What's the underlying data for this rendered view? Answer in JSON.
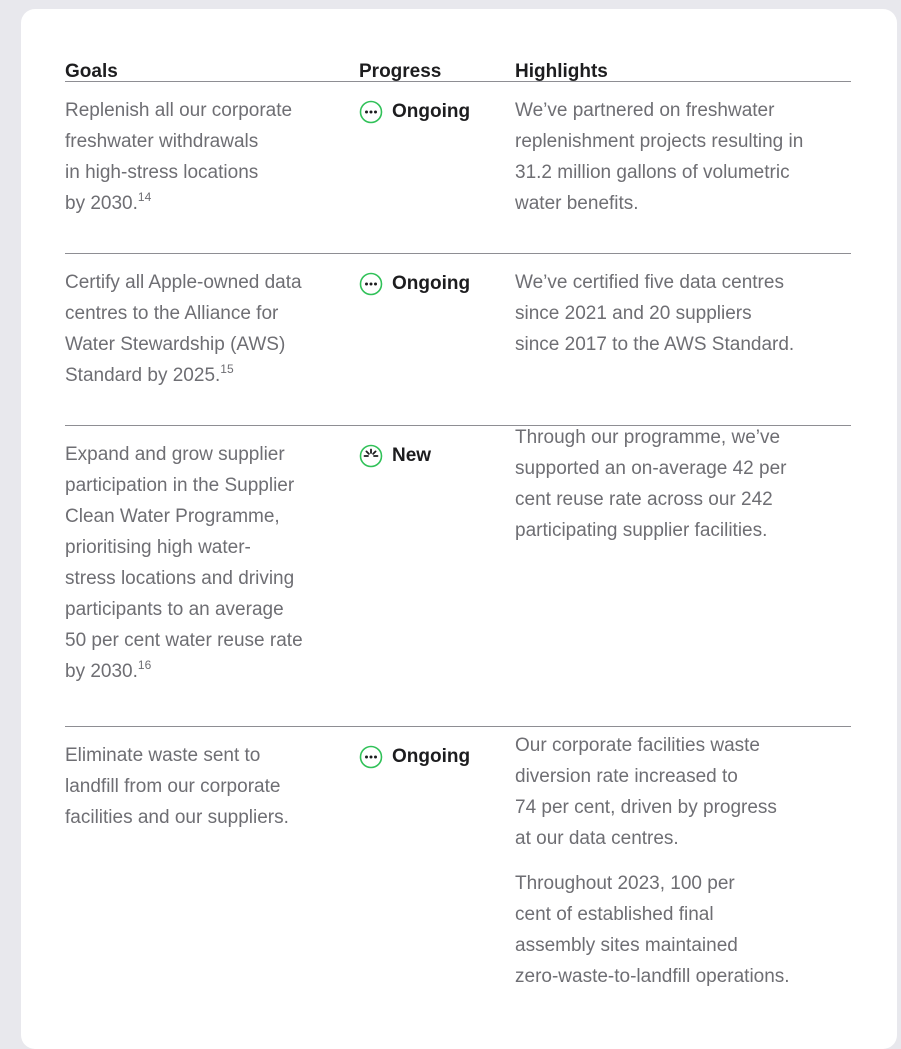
{
  "header": {
    "goals": "Goals",
    "progress": "Progress",
    "highlights": "Highlights"
  },
  "colors": {
    "status_green": "#30c158"
  },
  "rows": [
    {
      "goal_lines": [
        "Replenish all our corporate",
        "freshwater withdrawals",
        "in high-stress locations",
        "by 2030."
      ],
      "goal_sup": "14",
      "status": "Ongoing",
      "status_icon": "ellipsis-circle-icon",
      "highlights": [
        [
          "We’ve partnered on freshwater",
          "replenishment projects resulting in",
          "31.2 million gallons of volumetric",
          "water benefits."
        ]
      ]
    },
    {
      "goal_lines": [
        "Certify all Apple-owned data",
        "centres to the Alliance for",
        "Water Stewardship (AWS)",
        "Standard by 2025."
      ],
      "goal_sup": "15",
      "status": "Ongoing",
      "status_icon": "ellipsis-circle-icon",
      "highlights": [
        [
          "We’ve certified five data centres",
          "since 2021 and 20 suppliers",
          "since 2017 to the AWS Standard."
        ]
      ]
    },
    {
      "goal_lines": [
        "Expand and grow supplier",
        "participation in the Supplier",
        "Clean Water Programme,",
        "prioritising high water-",
        "stress locations and driving",
        "participants to an average",
        "50 per cent water reuse rate",
        "by 2030."
      ],
      "goal_sup": "16",
      "status": "New",
      "status_icon": "sparkle-circle-icon",
      "highlights": [
        [
          "Through our programme, we’ve",
          "supported an on-average 42 per",
          "cent reuse rate across our 242",
          "participating supplier facilities."
        ]
      ]
    },
    {
      "goal_lines": [
        "Eliminate waste sent to",
        "landfill from our corporate",
        "facilities and our suppliers."
      ],
      "goal_sup": "",
      "status": "Ongoing",
      "status_icon": "ellipsis-circle-icon",
      "highlights": [
        [
          "Our corporate facilities waste",
          "diversion rate increased to",
          "74 per cent, driven by progress",
          "at our data centres."
        ],
        [
          "Throughout 2023, 100 per",
          "cent of established final",
          "assembly sites maintained",
          "zero-waste-to-landfill operations."
        ]
      ]
    }
  ]
}
